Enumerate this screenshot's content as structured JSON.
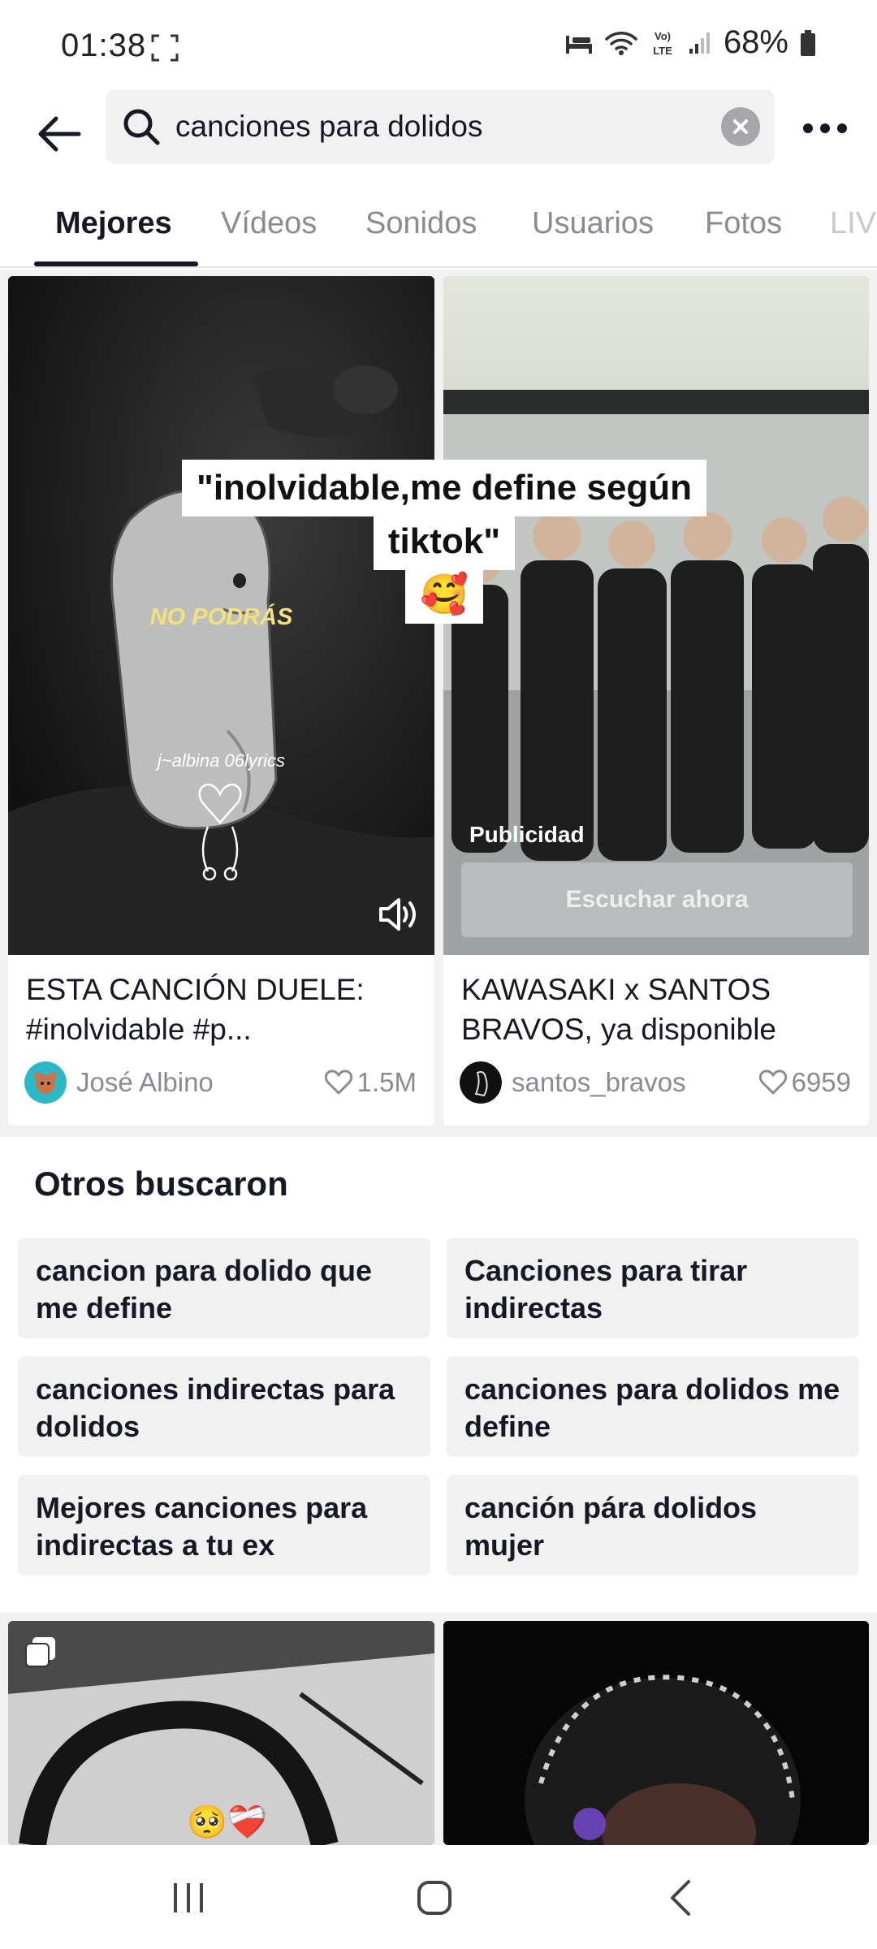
{
  "status_bar": {
    "time": "01:38",
    "battery": "68%",
    "lte_label": "LTE"
  },
  "search": {
    "value": "canciones para dolidos"
  },
  "tabs": [
    {
      "label": "Mejores",
      "active": true
    },
    {
      "label": "Vídeos",
      "active": false
    },
    {
      "label": "Sonidos",
      "active": false
    },
    {
      "label": "Usuarios",
      "active": false
    },
    {
      "label": "Fotos",
      "active": false
    },
    {
      "label": "LIVE",
      "active": false
    }
  ],
  "results": [
    {
      "title": "ESTA CANCIÓN DUELE: #inolvidable #p...",
      "author": "José Albino",
      "likes": "1.5M",
      "thumb_text": "NO PODRÁS",
      "watermark": "j~albina 06lyrics"
    },
    {
      "title": "KAWASAKI x SANTOS BRAVOS, ya disponible",
      "author": "santos_bravos",
      "likes": "6959",
      "ad_label": "Publicidad",
      "cta": "Escuchar ahora"
    }
  ],
  "overlay_caption": {
    "line1": "\"inolvidable,me define según",
    "line2": "tiktok\"",
    "emoji": "🥰"
  },
  "others": {
    "title": "Otros buscaron",
    "suggestions": [
      "cancion para dolido que me define",
      "Canciones para tirar indirectas",
      "canciones indirectas para dolidos",
      "canciones para dolidos me define",
      "Mejores canciones para indirectas a tu ex",
      "canción pára dolidos mujer"
    ]
  },
  "bottom_cards": {
    "emoji": "🥺❤️‍🩹"
  },
  "colors": {
    "accent_text": "#161823",
    "muted_text": "#8a8b91",
    "background_grey": "#f1f1f2",
    "thumb_yellow_text": "#f3e27a"
  }
}
